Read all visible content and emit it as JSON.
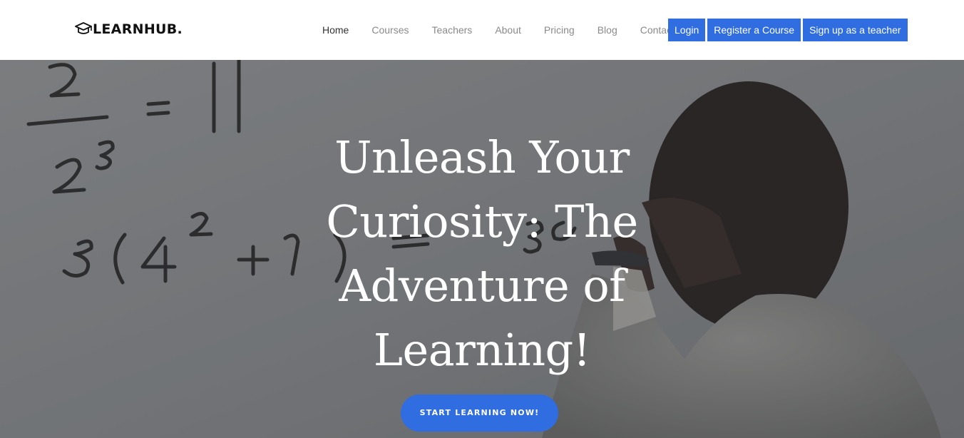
{
  "brand": {
    "name": "LEARNHUB.",
    "icon": "graduation-cap-icon"
  },
  "nav": {
    "links": [
      "Home",
      "Courses",
      "Teachers",
      "About",
      "Pricing",
      "Blog",
      "Contact"
    ],
    "active": "Home",
    "buttons": [
      "Login",
      "Register a Course",
      "Sign up as a teacher"
    ]
  },
  "hero": {
    "title": "Unleash Your Curiosity: The Adventure of Learning!",
    "cta": "START LEARNING NOW!",
    "chalkboard": [
      "2",
      "=",
      "4",
      "2",
      "3",
      "3(4",
      "2",
      "+1)",
      "="
    ]
  },
  "colors": {
    "accent": "#2f6de1",
    "nav_text": "#8a8a8a",
    "nav_active": "#333333",
    "hero_overlay": "#6e7175"
  }
}
